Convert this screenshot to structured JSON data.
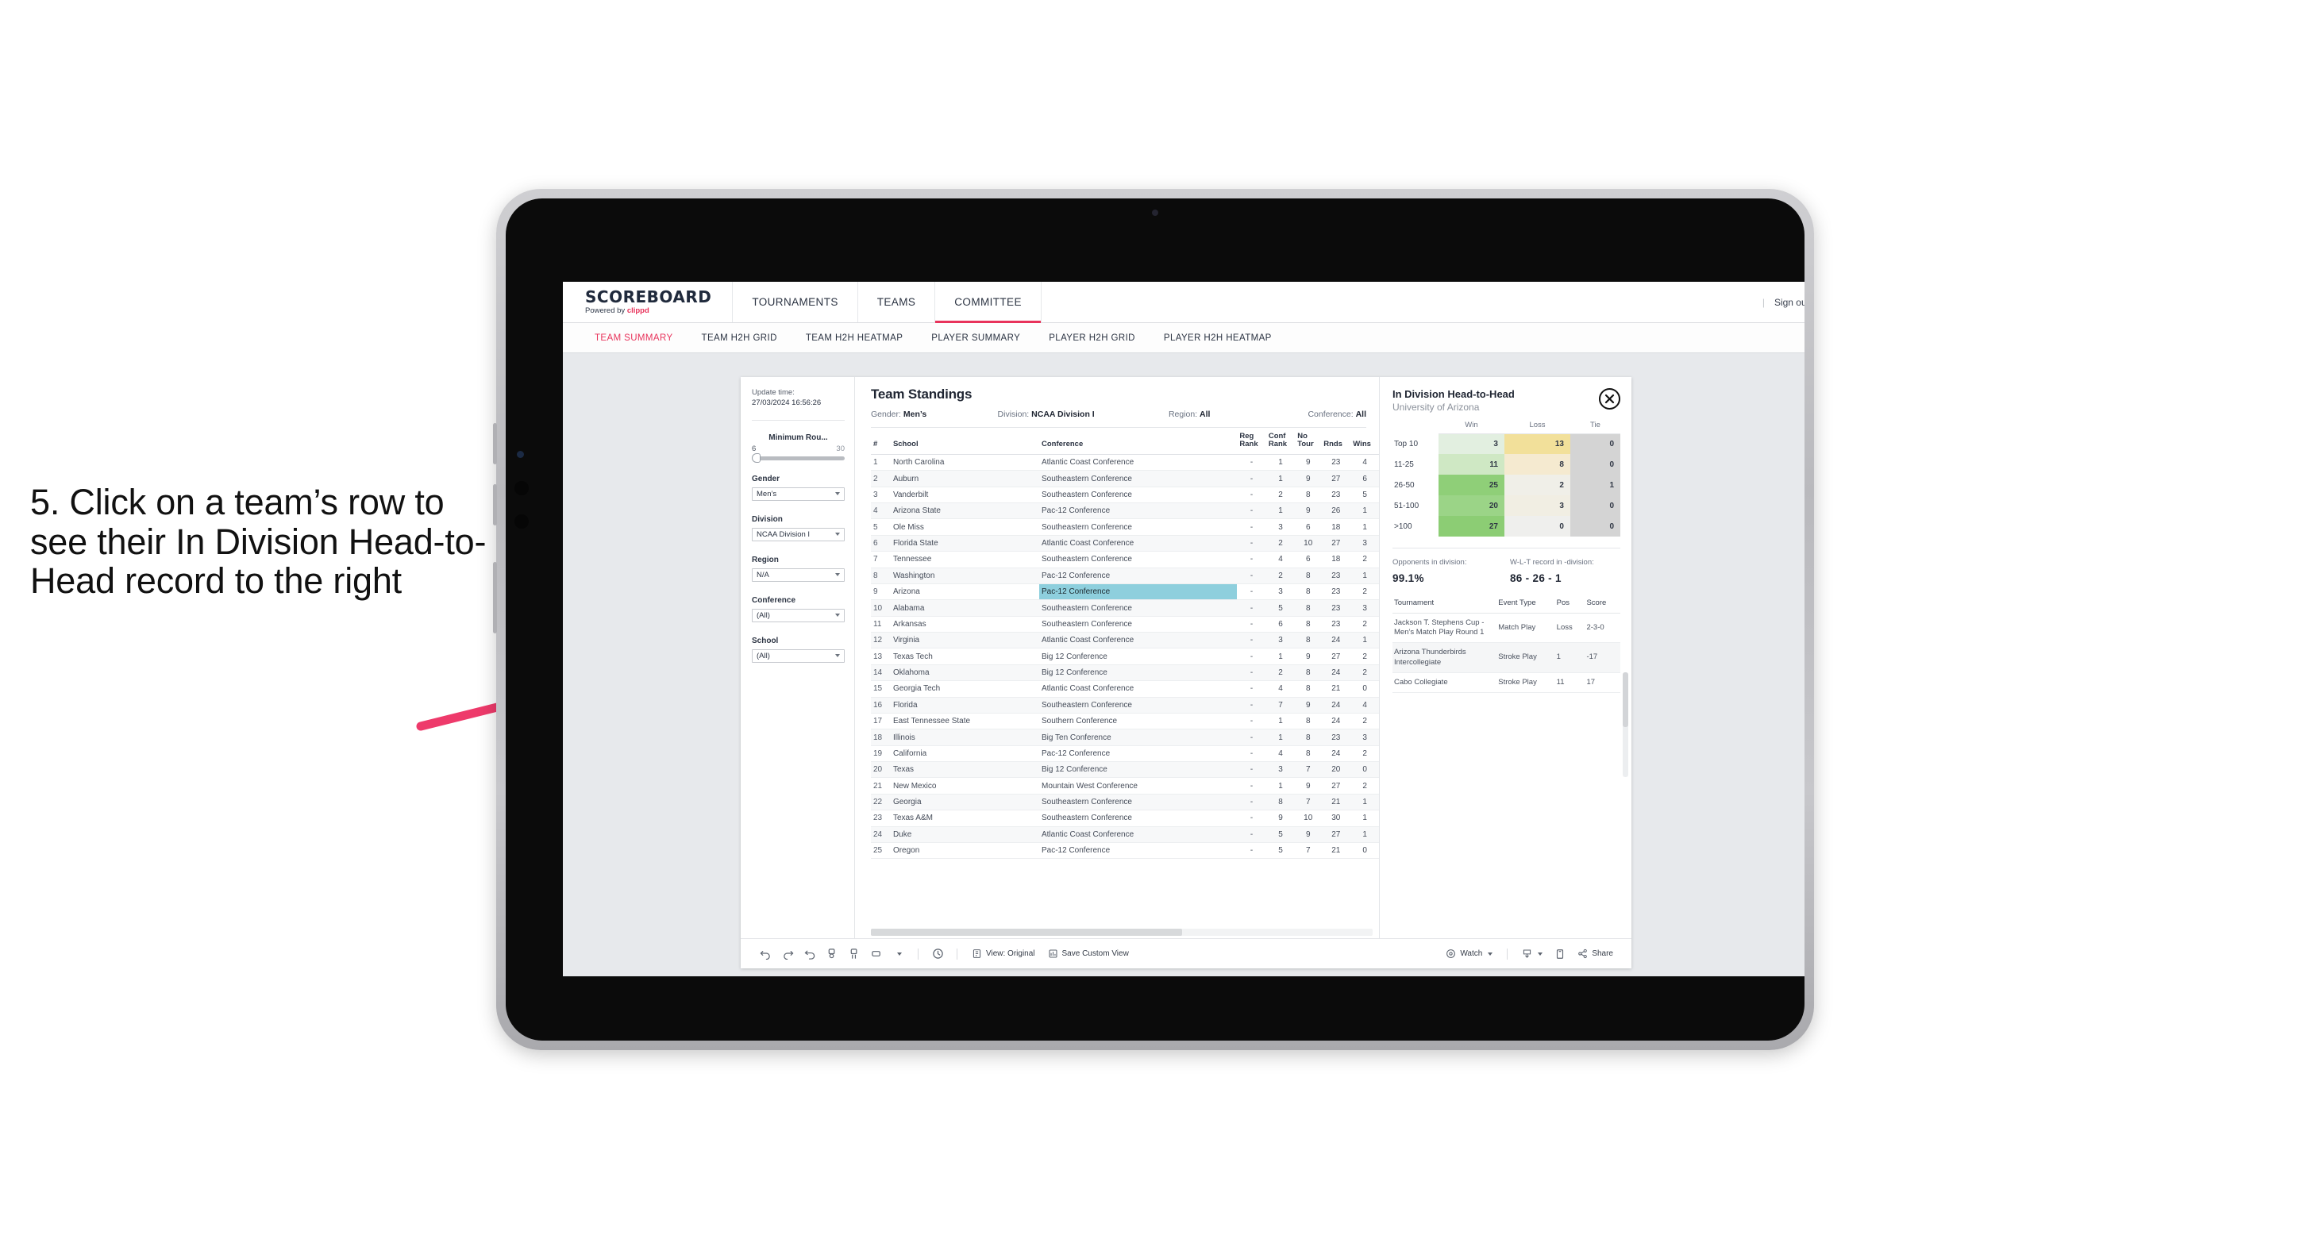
{
  "caption": "5. Click on a team’s row to see their In Division Head-to-Head record to the right",
  "colors": {
    "accent": "#e8335b",
    "highlight": "#8ecfdd",
    "win": "#8bcf76",
    "loss": "#efe09a",
    "tie": "#d4d4d4"
  },
  "topnav": {
    "brand_title": "SCOREBOARD",
    "brand_sub_prefix": "Powered by ",
    "brand_sub_name": "clippd",
    "items": [
      {
        "label": "TOURNAMENTS",
        "active": false
      },
      {
        "label": "TEAMS",
        "active": false
      },
      {
        "label": "COMMITTEE",
        "active": true
      }
    ],
    "divider": "|",
    "signout": "Sign out"
  },
  "subnav": {
    "items": [
      {
        "label": "TEAM SUMMARY",
        "active": true
      },
      {
        "label": "TEAM H2H GRID",
        "active": false
      },
      {
        "label": "TEAM H2H HEATMAP",
        "active": false
      },
      {
        "label": "PLAYER SUMMARY",
        "active": false
      },
      {
        "label": "PLAYER H2H GRID",
        "active": false
      },
      {
        "label": "PLAYER H2H HEATMAP",
        "active": false
      }
    ]
  },
  "rail": {
    "update_label": "Update time:",
    "update_value": "27/03/2024 16:56:26",
    "min_rounds": {
      "label": "Minimum Rou...",
      "min": "6",
      "max": "30"
    },
    "filters": [
      {
        "label": "Gender",
        "value": "Men’s"
      },
      {
        "label": "Division",
        "value": "NCAA Division I"
      },
      {
        "label": "Region",
        "value": "N/A"
      },
      {
        "label": "Conference",
        "value": "(All)"
      },
      {
        "label": "School",
        "value": "(All)"
      }
    ]
  },
  "standings": {
    "title": "Team Standings",
    "meta": [
      {
        "label": "Gender: ",
        "value": "Men’s"
      },
      {
        "label": "Division: ",
        "value": "NCAA Division I"
      },
      {
        "label": "Region: ",
        "value": "All"
      },
      {
        "label": "Conference: ",
        "value": "All"
      }
    ],
    "columns": [
      "#",
      "School",
      "Conference",
      "Reg Rank",
      "Conf Rank",
      "No Tour",
      "Rnds",
      "Wins"
    ],
    "columns_wrapped": [
      {
        "l1": "#",
        "l2": ""
      },
      {
        "l1": "School",
        "l2": ""
      },
      {
        "l1": "Conference",
        "l2": ""
      },
      {
        "l1": "Reg",
        "l2": "Rank"
      },
      {
        "l1": "Conf",
        "l2": "Rank"
      },
      {
        "l1": "No",
        "l2": "Tour"
      },
      {
        "l1": "Rnds",
        "l2": ""
      },
      {
        "l1": "Wins",
        "l2": ""
      }
    ],
    "rows": [
      {
        "n": "1",
        "school": "North Carolina",
        "conf": "Atlantic Coast Conference",
        "reg": "-",
        "crank": "1",
        "notour": "9",
        "rnds": "23",
        "wins": "4",
        "hl": false
      },
      {
        "n": "2",
        "school": "Auburn",
        "conf": "Southeastern Conference",
        "reg": "-",
        "crank": "1",
        "notour": "9",
        "rnds": "27",
        "wins": "6",
        "hl": false
      },
      {
        "n": "3",
        "school": "Vanderbilt",
        "conf": "Southeastern Conference",
        "reg": "-",
        "crank": "2",
        "notour": "8",
        "rnds": "23",
        "wins": "5",
        "hl": false
      },
      {
        "n": "4",
        "school": "Arizona State",
        "conf": "Pac-12 Conference",
        "reg": "-",
        "crank": "1",
        "notour": "9",
        "rnds": "26",
        "wins": "1",
        "hl": false
      },
      {
        "n": "5",
        "school": "Ole Miss",
        "conf": "Southeastern Conference",
        "reg": "-",
        "crank": "3",
        "notour": "6",
        "rnds": "18",
        "wins": "1",
        "hl": false
      },
      {
        "n": "6",
        "school": "Florida State",
        "conf": "Atlantic Coast Conference",
        "reg": "-",
        "crank": "2",
        "notour": "10",
        "rnds": "27",
        "wins": "3",
        "hl": false
      },
      {
        "n": "7",
        "school": "Tennessee",
        "conf": "Southeastern Conference",
        "reg": "-",
        "crank": "4",
        "notour": "6",
        "rnds": "18",
        "wins": "2",
        "hl": false
      },
      {
        "n": "8",
        "school": "Washington",
        "conf": "Pac-12 Conference",
        "reg": "-",
        "crank": "2",
        "notour": "8",
        "rnds": "23",
        "wins": "1",
        "hl": false
      },
      {
        "n": "9",
        "school": "Arizona",
        "conf": "Pac-12 Conference",
        "reg": "-",
        "crank": "3",
        "notour": "8",
        "rnds": "23",
        "wins": "2",
        "hl": true
      },
      {
        "n": "10",
        "school": "Alabama",
        "conf": "Southeastern Conference",
        "reg": "-",
        "crank": "5",
        "notour": "8",
        "rnds": "23",
        "wins": "3",
        "hl": false
      },
      {
        "n": "11",
        "school": "Arkansas",
        "conf": "Southeastern Conference",
        "reg": "-",
        "crank": "6",
        "notour": "8",
        "rnds": "23",
        "wins": "2",
        "hl": false
      },
      {
        "n": "12",
        "school": "Virginia",
        "conf": "Atlantic Coast Conference",
        "reg": "-",
        "crank": "3",
        "notour": "8",
        "rnds": "24",
        "wins": "1",
        "hl": false
      },
      {
        "n": "13",
        "school": "Texas Tech",
        "conf": "Big 12 Conference",
        "reg": "-",
        "crank": "1",
        "notour": "9",
        "rnds": "27",
        "wins": "2",
        "hl": false
      },
      {
        "n": "14",
        "school": "Oklahoma",
        "conf": "Big 12 Conference",
        "reg": "-",
        "crank": "2",
        "notour": "8",
        "rnds": "24",
        "wins": "2",
        "hl": false
      },
      {
        "n": "15",
        "school": "Georgia Tech",
        "conf": "Atlantic Coast Conference",
        "reg": "-",
        "crank": "4",
        "notour": "8",
        "rnds": "21",
        "wins": "0",
        "hl": false
      },
      {
        "n": "16",
        "school": "Florida",
        "conf": "Southeastern Conference",
        "reg": "-",
        "crank": "7",
        "notour": "9",
        "rnds": "24",
        "wins": "4",
        "hl": false
      },
      {
        "n": "17",
        "school": "East Tennessee State",
        "conf": "Southern Conference",
        "reg": "-",
        "crank": "1",
        "notour": "8",
        "rnds": "24",
        "wins": "2",
        "hl": false
      },
      {
        "n": "18",
        "school": "Illinois",
        "conf": "Big Ten Conference",
        "reg": "-",
        "crank": "1",
        "notour": "8",
        "rnds": "23",
        "wins": "3",
        "hl": false
      },
      {
        "n": "19",
        "school": "California",
        "conf": "Pac-12 Conference",
        "reg": "-",
        "crank": "4",
        "notour": "8",
        "rnds": "24",
        "wins": "2",
        "hl": false
      },
      {
        "n": "20",
        "school": "Texas",
        "conf": "Big 12 Conference",
        "reg": "-",
        "crank": "3",
        "notour": "7",
        "rnds": "20",
        "wins": "0",
        "hl": false
      },
      {
        "n": "21",
        "school": "New Mexico",
        "conf": "Mountain West Conference",
        "reg": "-",
        "crank": "1",
        "notour": "9",
        "rnds": "27",
        "wins": "2",
        "hl": false
      },
      {
        "n": "22",
        "school": "Georgia",
        "conf": "Southeastern Conference",
        "reg": "-",
        "crank": "8",
        "notour": "7",
        "rnds": "21",
        "wins": "1",
        "hl": false
      },
      {
        "n": "23",
        "school": "Texas A&M",
        "conf": "Southeastern Conference",
        "reg": "-",
        "crank": "9",
        "notour": "10",
        "rnds": "30",
        "wins": "1",
        "hl": false
      },
      {
        "n": "24",
        "school": "Duke",
        "conf": "Atlantic Coast Conference",
        "reg": "-",
        "crank": "5",
        "notour": "9",
        "rnds": "27",
        "wins": "1",
        "hl": false
      },
      {
        "n": "25",
        "school": "Oregon",
        "conf": "Pac-12 Conference",
        "reg": "-",
        "crank": "5",
        "notour": "7",
        "rnds": "21",
        "wins": "0",
        "hl": false
      }
    ]
  },
  "h2h": {
    "title": "In Division Head-to-Head",
    "subtitle": "University of Arizona",
    "close_icon": "close-icon",
    "chart_data": {
      "type": "heatmap",
      "title": "In Division Head-to-Head",
      "subtitle": "University of Arizona",
      "columns": [
        "Win",
        "Loss",
        "Tie"
      ],
      "rows": [
        "Top 10",
        "11-25",
        "26-50",
        "51-100",
        ">100"
      ],
      "values": [
        [
          3,
          13,
          0
        ],
        [
          11,
          8,
          0
        ],
        [
          25,
          2,
          1
        ],
        [
          20,
          3,
          0
        ],
        [
          27,
          0,
          0
        ]
      ],
      "cell_colors": [
        [
          "#e2efe0",
          "#f2e09a",
          "#d4d4d4"
        ],
        [
          "#cfe8c4",
          "#f5ead0",
          "#d4d4d4"
        ],
        [
          "#8fcf78",
          "#f0efe8",
          "#d4d4d4"
        ],
        [
          "#9bd487",
          "#f1eee3",
          "#d4d4d4"
        ],
        [
          "#8ccd74",
          "#efefed",
          "#d4d4d4"
        ]
      ]
    },
    "stats": [
      {
        "label": "Opponents in division:",
        "value": "99.1%"
      },
      {
        "label": "W-L-T record in -division:",
        "value": "86 - 26 - 1"
      }
    ],
    "tournaments": {
      "columns": [
        "Tournament",
        "Event Type",
        "Pos",
        "Score"
      ],
      "rows": [
        {
          "name": "Jackson T. Stephens Cup - Men’s Match Play Round 1",
          "type": "Match Play",
          "pos": "Loss",
          "score": "2-3-0"
        },
        {
          "name": "Arizona Thunderbirds Intercollegiate",
          "type": "Stroke Play",
          "pos": "1",
          "score": "-17"
        },
        {
          "name": "Cabo Collegiate",
          "type": "Stroke Play",
          "pos": "11",
          "score": "17"
        }
      ]
    }
  },
  "toolbar": {
    "icons": [
      "undo-icon",
      "redo-icon",
      "revert-icon",
      "pause-refresh-icon",
      "refresh-icon",
      "device-layout-icon"
    ],
    "clock_icon": "clock-icon",
    "view_label": "View: Original",
    "save_label": "Save Custom View",
    "watch_label": "Watch",
    "share_label": "Share",
    "download_icon": "download-icon",
    "fullscreen_icon": "fullscreen-icon",
    "comment_icon": "comment-icon"
  }
}
